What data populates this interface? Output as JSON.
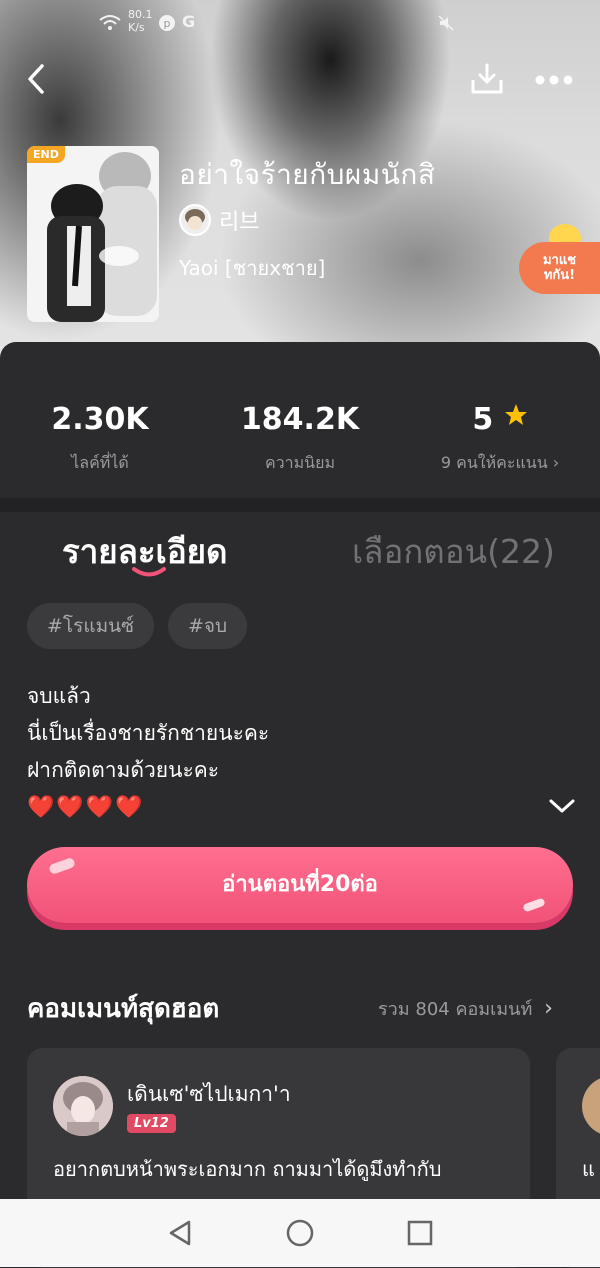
{
  "status_bar": {
    "net_speed_value": "80.1",
    "net_speed_unit": "K/s",
    "g_label": "G"
  },
  "header": {
    "back_icon": "chevron-left-icon",
    "download_icon": "download-icon",
    "more_icon": "more-dots-icon"
  },
  "book": {
    "badge": "END",
    "title": "อย่าใจร้ายกับผมนักสิ",
    "author": "리브",
    "genre": "Yaoi [ชายxชาย]"
  },
  "chat_bubble": {
    "label_line1": "มาแช",
    "label_line2": "ทกัน!"
  },
  "stats": [
    {
      "value": "2.30K",
      "label": "ไลค์ที่ได้"
    },
    {
      "value": "184.2K",
      "label": "ความนิยม"
    },
    {
      "value": "5",
      "label": "9 คนให้คะแนน"
    }
  ],
  "tabs": {
    "details": "รายละเอียด",
    "chapters": "เลือกตอน(22)"
  },
  "tags": [
    "#โรแมนซ์",
    "#จบ"
  ],
  "description": {
    "line1": "จบแล้ว",
    "line2": "นี่เป็นเรื่องชายรักชายนะคะ",
    "line3": "ฝากติดตามด้วยนะคะ",
    "hearts": "❤️❤️❤️❤️"
  },
  "read_button": {
    "label": "อ่านตอนที่20ต่อ"
  },
  "hot_comments": {
    "title": "คอมเมนท์สุดฮอต",
    "total": "รวม 804 คอมเมนท์",
    "items": [
      {
        "user": "เดินเซ'ซไปเมกา'า",
        "level": "Lv12",
        "text": "อยากตบหน้าพระเอกมาก ถามมาได้ดูมึงทำกับ"
      }
    ],
    "peek_text": "แ"
  },
  "colors": {
    "accent": "#f25278",
    "badge": "#f5a623",
    "card_bg": "#2b2b2d"
  }
}
